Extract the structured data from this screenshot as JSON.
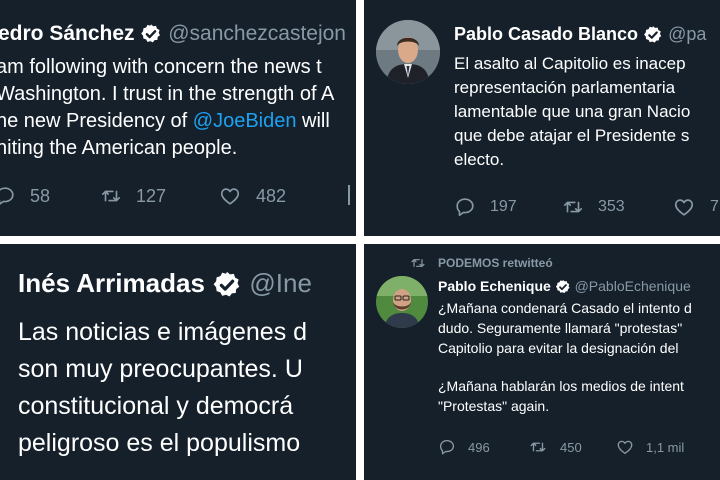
{
  "tweet1": {
    "name": "edro Sánchez",
    "handle": "@sanchezcastejon",
    "lines": [
      "am following with concern the news t",
      "Washington. I trust in the strength of A",
      "he new Presidency of ",
      "@JoeBiden",
      " will",
      "niting the American people."
    ],
    "replies": "58",
    "retweets": "127",
    "likes": "482"
  },
  "tweet2": {
    "name": "Pablo Casado Blanco",
    "handle": "@pa",
    "lines": [
      "El asalto al Capitolio es inacep",
      "representación parlamentaria",
      "lamentable que una gran Nacio",
      "que debe atajar el Presidente s",
      "electo."
    ],
    "replies": "197",
    "retweets": "353",
    "likes": "7"
  },
  "tweet3": {
    "name": "Inés Arrimadas",
    "handle": "@Ine",
    "lines": [
      "Las noticias e imágenes d",
      "son muy preocupantes. U",
      "constitucional y democrá",
      "peligroso es el populismo"
    ]
  },
  "tweet4": {
    "retweeted_by": "PODEMOS retwitteó",
    "name": "Pablo Echenique",
    "handle": "@PabloEchenique",
    "lines": [
      "¿Mañana condenará Casado el intento d",
      "dudo. Seguramente llamará \"protestas\"",
      "Capitolio para evitar la designación del",
      "¿Mañana hablarán los medios de intent",
      "\"Protestas\" again."
    ],
    "replies": "496",
    "retweets": "450",
    "likes": "1,1 mil"
  },
  "colors": {
    "background": "#15202b",
    "text": "#ffffff",
    "secondary": "#8899a6",
    "link": "#1da1f2"
  },
  "icons": [
    "verified-badge-icon",
    "reply-icon",
    "retweet-icon",
    "like-icon",
    "share-icon"
  ]
}
